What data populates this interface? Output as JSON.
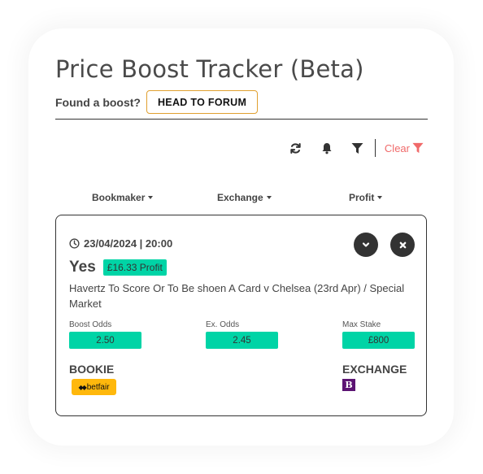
{
  "header": {
    "title": "Price Boost Tracker (Beta)",
    "found_label": "Found a boost?",
    "forum_button": "HEAD TO FORUM"
  },
  "toolbar": {
    "icons": [
      "refresh-icon",
      "bell-icon",
      "filter-icon"
    ],
    "clear_label": "Clear",
    "clear_color": "#f06a6a"
  },
  "sort": {
    "bookmaker": "Bookmaker",
    "exchange": "Exchange",
    "profit": "Profit"
  },
  "boost": {
    "datetime": "23/04/2024 | 20:00",
    "outcome": "Yes",
    "profit": "£16.33 Profit",
    "market": "Havertz To Score Or To Be shoen A Card v Chelsea (23rd Apr) / Special Market",
    "boost_odds_label": "Boost Odds",
    "boost_odds": "2.50",
    "ex_odds_label": "Ex. Odds",
    "ex_odds": "2.45",
    "max_stake_label": "Max Stake",
    "max_stake": "£800",
    "bookie_label": "BOOKIE",
    "bookie_name": "betfair",
    "exchange_label": "EXCHANGE",
    "exchange_logo_letter": "B",
    "accent_color": "#00d4a6"
  }
}
